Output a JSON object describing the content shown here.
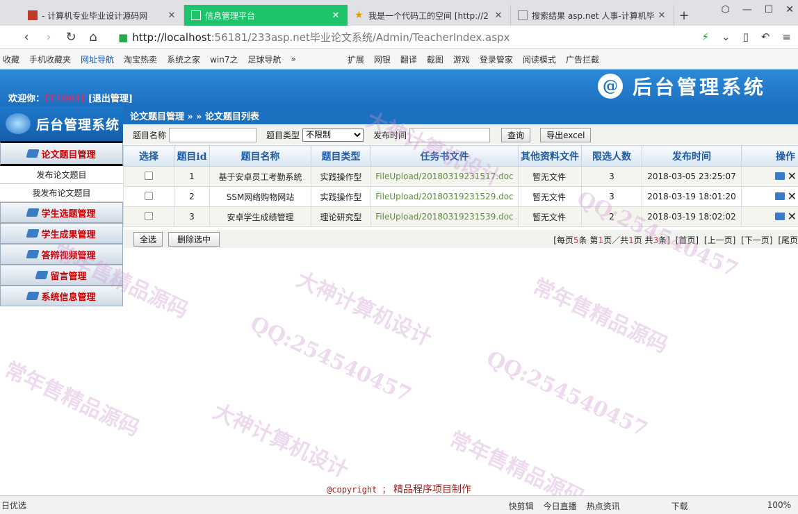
{
  "browser": {
    "tabs": [
      {
        "title": "- 计算机专业毕业设计源码网",
        "active": false
      },
      {
        "title": "信息管理平台",
        "active": true
      },
      {
        "title": "我是一个代码工的空间 [http://2",
        "active": false
      },
      {
        "title": "搜索结果 asp.net 人事-计算机毕",
        "active": false
      }
    ],
    "url_host": "http://localhost",
    "url_rest": ":56181/233asp.net毕业论文系统/Admin/TeacherIndex.aspx",
    "bookmarks": [
      "收藏",
      "手机收藏夹",
      "网址导航",
      "淘宝热卖",
      "系统之家",
      "win7之",
      "足球导航",
      "»"
    ],
    "tools": [
      "扩展",
      "网银",
      "翻译",
      "截图",
      "游戏",
      "登录管家",
      "阅读模式",
      "广告拦截"
    ],
    "status_left": "日优选",
    "status_right": [
      "快剪辑",
      "今日直播",
      "热点资讯",
      "下载",
      "100%"
    ]
  },
  "header": {
    "welcome_prefix": "欢迎你：",
    "user_id": "[T1001]",
    "logout": "[退出管理]",
    "title": "后台管理系统",
    "at_symbol": "@"
  },
  "sidebar": {
    "logo_text": "后台管理系统",
    "menus": [
      {
        "label": "论文题目管理",
        "subs": [
          "发布论文题目",
          "我发布论文题目"
        ]
      },
      {
        "label": "学生选题管理",
        "subs": []
      },
      {
        "label": "学生成果管理",
        "subs": []
      },
      {
        "label": "答辩视频管理",
        "subs": []
      },
      {
        "label": "留言管理",
        "subs": []
      },
      {
        "label": "系统信息管理",
        "subs": []
      }
    ]
  },
  "breadcrumb": "论文题目管理 » » 论文题目列表",
  "search": {
    "title_label": "题目名称",
    "type_label": "题目类型",
    "type_value": "不限制",
    "time_label": "发布时间",
    "query_button": "查询",
    "export_button": "导出excel"
  },
  "table": {
    "headers": [
      "选择",
      "题目id",
      "题目名称",
      "题目类型",
      "任务书文件",
      "其他资料文件",
      "限选人数",
      "发布时间",
      "操作"
    ],
    "rows": [
      {
        "id": "1",
        "name": "基于安卓员工考勤系统",
        "type": "实践操作型",
        "file": "FileUpload/20180319231517.doc",
        "other": "暂无文件",
        "limit": "3",
        "time": "2018-03-05 23:25:07"
      },
      {
        "id": "2",
        "name": "SSM网络购物网站",
        "type": "实践操作型",
        "file": "FileUpload/20180319231529.doc",
        "other": "暂无文件",
        "limit": "3",
        "time": "2018-03-19 18:01:20"
      },
      {
        "id": "3",
        "name": "安卓学生成绩管理",
        "type": "理论研究型",
        "file": "FileUpload/20180319231539.doc",
        "other": "暂无文件",
        "limit": "2",
        "time": "2018-03-19 18:02:02"
      }
    ]
  },
  "footer": {
    "select_all": "全选",
    "delete_selected": "删除选中",
    "pager": {
      "p1": "[每页",
      "per": "5",
      "p2": "条 第",
      "cur": "1",
      "p3": "页／共",
      "total_pages": "1",
      "p4": "页 共",
      "total": "3",
      "p5": "条]",
      "first": "[首页]",
      "prev": "[上一页]",
      "next": "[下一页]",
      "last": "[尾页"
    }
  },
  "copyright": {
    "mono": "@copyright ；",
    "text": " 精品程序项目制作"
  },
  "watermarks": [
    "常年售精品源码",
    "大神计算机设计",
    "QQ:254540457"
  ]
}
